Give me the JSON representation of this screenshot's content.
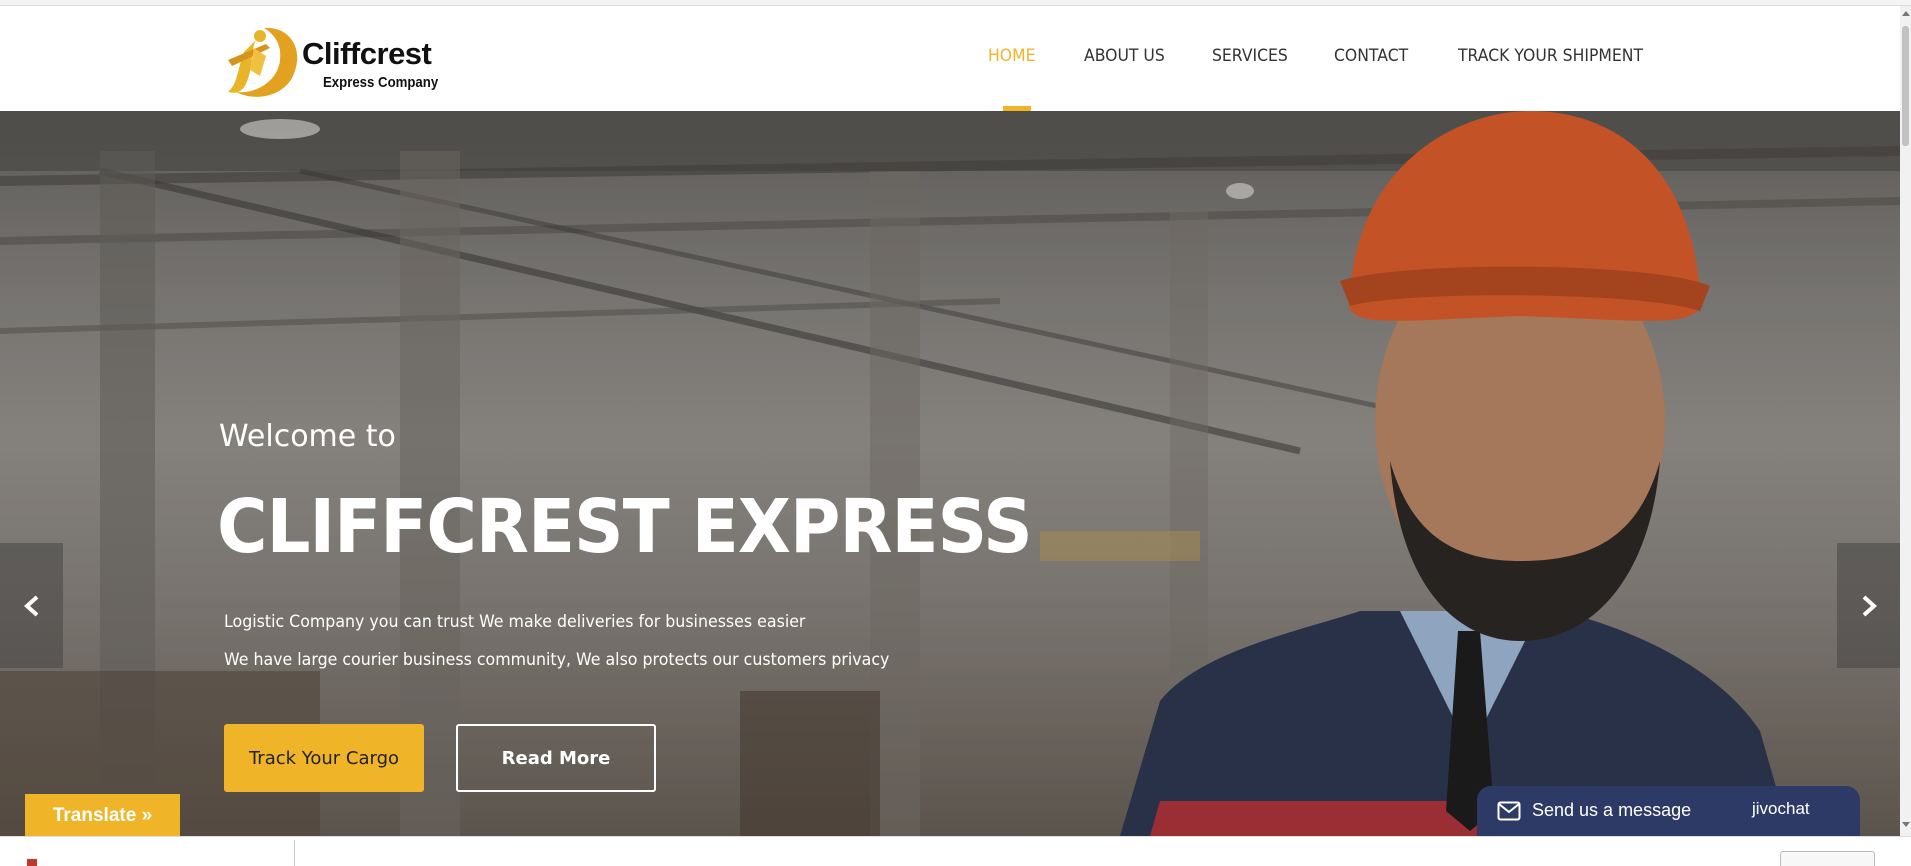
{
  "brand": {
    "name": "Cliffcrest",
    "tagline": "Express Company",
    "accent_color": "#f0b429"
  },
  "nav": {
    "items": [
      {
        "label": "HOME",
        "active": true
      },
      {
        "label": "ABOUT US",
        "active": false
      },
      {
        "label": "SERVICES",
        "active": false
      },
      {
        "label": "CONTACT",
        "active": false
      },
      {
        "label": "TRACK YOUR SHIPMENT",
        "active": false
      }
    ]
  },
  "hero": {
    "welcome": "Welcome to",
    "title": "CLIFFCREST EXPRESS",
    "line1": "Logistic Company you can trust We make deliveries for businesses easier",
    "line2": "We have large courier business community, We also protects our customers privacy",
    "primary_button": "Track Your Cargo",
    "secondary_button": "Read More",
    "prev_icon": "chevron-left-icon",
    "next_icon": "chevron-right-icon"
  },
  "widgets": {
    "translate_label": "Translate »",
    "chat_label": "Send us a message",
    "chat_brand": "jivochat",
    "chat_color": "#2e3a66"
  }
}
